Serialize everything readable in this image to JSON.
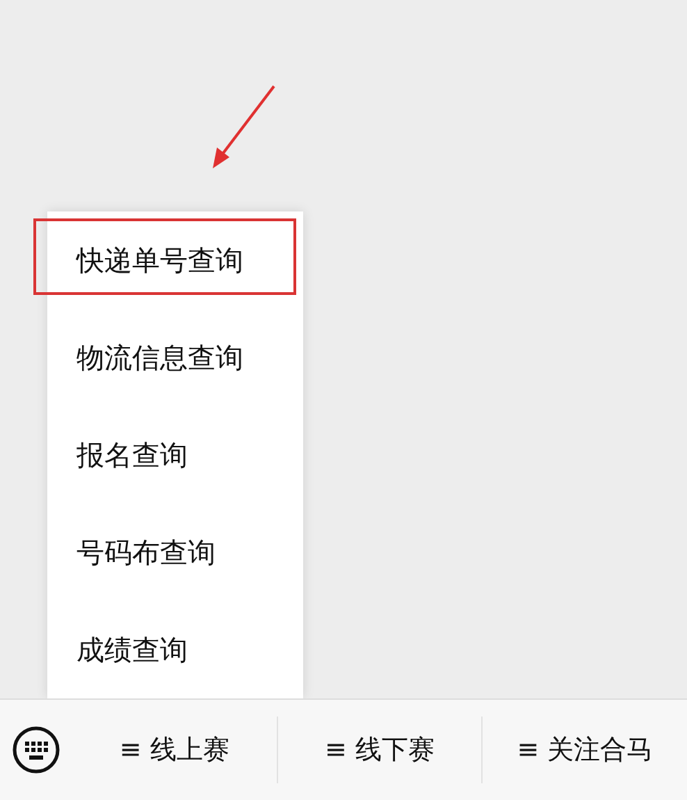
{
  "popup_menu": {
    "items": [
      {
        "label": "快递单号查询",
        "highlighted": true
      },
      {
        "label": "物流信息查询",
        "highlighted": false
      },
      {
        "label": "报名查询",
        "highlighted": false
      },
      {
        "label": "号码布查询",
        "highlighted": false
      },
      {
        "label": "成绩查询",
        "highlighted": false
      }
    ]
  },
  "bottom_menu": {
    "tabs": [
      {
        "label": "≡ 线上赛"
      },
      {
        "label": "≡ 线下赛"
      },
      {
        "label": "≡ 关注合马"
      }
    ]
  }
}
